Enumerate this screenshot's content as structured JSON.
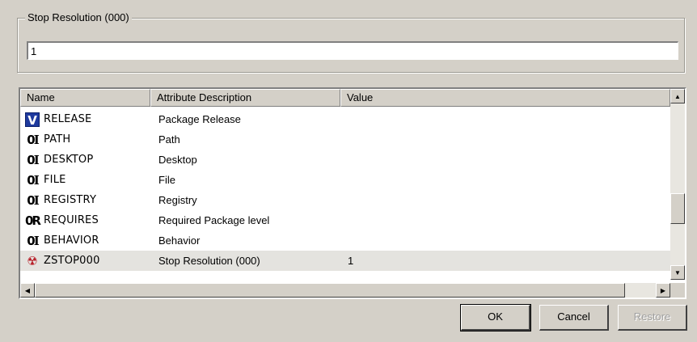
{
  "group": {
    "label": "Stop Resolution (000)"
  },
  "input": {
    "value": "1"
  },
  "columns": [
    "Name",
    "Attribute Description",
    "Value"
  ],
  "rows": [
    {
      "icon": "v-icon",
      "name": "RELEASE",
      "desc": "Package Release",
      "value": ""
    },
    {
      "icon": "clip-i-icon",
      "name": "PATH",
      "desc": "Path",
      "value": ""
    },
    {
      "icon": "clip-i-icon",
      "name": "DESKTOP",
      "desc": "Desktop",
      "value": ""
    },
    {
      "icon": "clip-i-icon",
      "name": "FILE",
      "desc": "File",
      "value": ""
    },
    {
      "icon": "clip-i-icon",
      "name": "REGISTRY",
      "desc": "Registry",
      "value": ""
    },
    {
      "icon": "clip-r-icon",
      "name": "REQUIRES",
      "desc": "Required Package level",
      "value": ""
    },
    {
      "icon": "clip-i-icon",
      "name": "BEHAVIOR",
      "desc": "Behavior",
      "value": ""
    },
    {
      "icon": "stop-icon",
      "name": "ZSTOP000",
      "desc": "Stop Resolution (000)",
      "value": "1"
    }
  ],
  "buttons": {
    "ok": "OK",
    "cancel": "Cancel",
    "restore": "Restore"
  },
  "colors": {
    "dialog_bg": "#d4d0c8",
    "selected_row": "#e4e3df",
    "v_icon": "#1f3a9e",
    "stop_icon": "#b8202a"
  }
}
